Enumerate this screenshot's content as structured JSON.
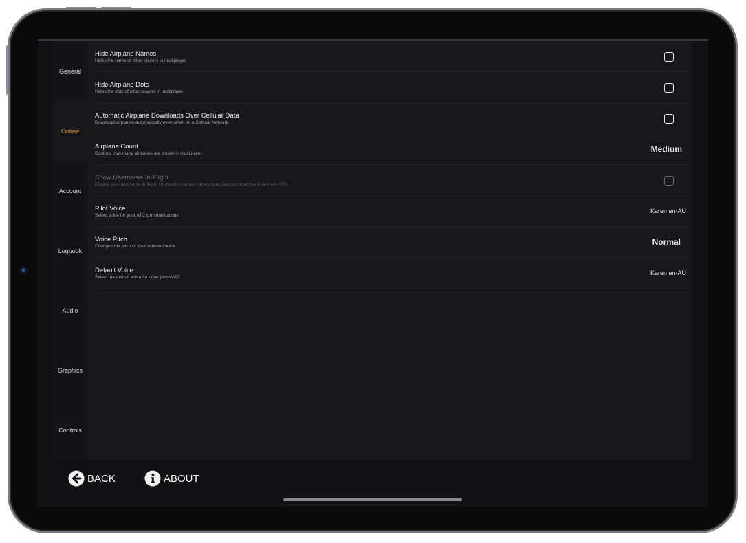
{
  "sidebar": {
    "items": [
      {
        "label": "General",
        "active": false
      },
      {
        "label": "Online",
        "active": true
      },
      {
        "label": "Account",
        "active": false
      },
      {
        "label": "Logbook",
        "active": false
      },
      {
        "label": "Audio",
        "active": false
      },
      {
        "label": "Graphics",
        "active": false
      },
      {
        "label": "Controls",
        "active": false
      }
    ]
  },
  "settings": [
    {
      "title": "Hide Airplane Names",
      "subtitle": "Hides the name of other players in multiplayer",
      "control": "checkbox",
      "checked": false
    },
    {
      "title": "Hide Airplane Dots",
      "subtitle": "Hides the dots of other players in multiplayer",
      "control": "checkbox",
      "checked": false
    },
    {
      "title": "Automatic Airplane Downloads Over Cellular Data",
      "subtitle": "Download airplanes automatically even when on a Cellular Network.",
      "control": "checkbox",
      "checked": false
    },
    {
      "title": "Airplane Count",
      "subtitle": "Controls how many airplanes are shown in multiplayer.",
      "control": "select",
      "value": "Medium"
    },
    {
      "title": "Show Username In-Flight",
      "subtitle": "Display your username in-flight. Uncheck to remain anonymous (account must be linked with IFC)",
      "control": "checkbox",
      "checked": false,
      "disabled": true
    },
    {
      "title": "Pilot Voice",
      "subtitle": "Select voice for your ATC communications",
      "control": "select",
      "value": "Karen en-AU"
    },
    {
      "title": "Voice Pitch",
      "subtitle": "Changes the pitch of your selected voice",
      "control": "select",
      "value": "Normal"
    },
    {
      "title": "Default Voice",
      "subtitle": "Select the default voice for other pilots/ATC",
      "control": "select",
      "value": "Karen en-AU"
    }
  ],
  "bottom_bar": {
    "back_label": "BACK",
    "about_label": "ABOUT"
  },
  "colors": {
    "accent": "#e09a3c",
    "background": "#121214"
  }
}
